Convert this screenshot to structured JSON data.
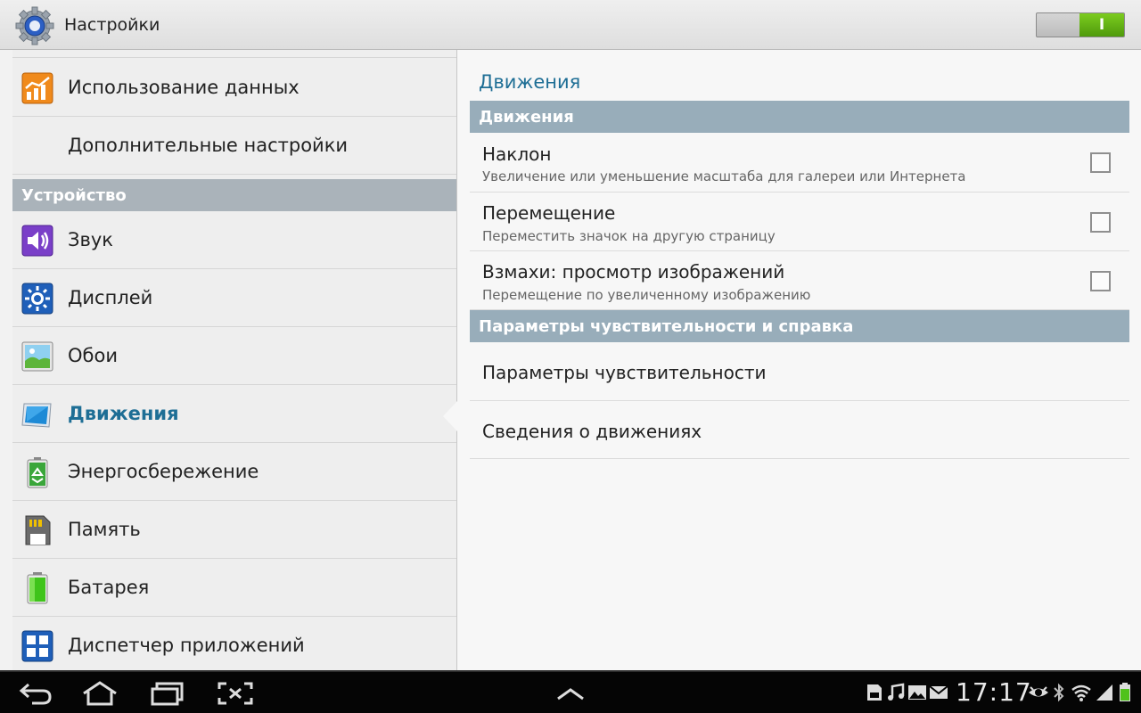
{
  "action_bar": {
    "title": "Настройки",
    "toggle_label": "I",
    "icon": "settings-gear-icon"
  },
  "sidebar": {
    "items_top": [
      {
        "label": "Использование данных",
        "icon": "data-usage-icon"
      },
      {
        "label": "Дополнительные настройки"
      }
    ],
    "section": "Устройство",
    "items": [
      {
        "label": "Звук",
        "icon": "sound-icon"
      },
      {
        "label": "Дисплей",
        "icon": "display-icon"
      },
      {
        "label": "Обои",
        "icon": "wallpaper-icon"
      },
      {
        "label": "Движения",
        "icon": "motion-icon",
        "active": true
      },
      {
        "label": "Энергосбережение",
        "icon": "power-saving-icon"
      },
      {
        "label": "Память",
        "icon": "storage-icon"
      },
      {
        "label": "Батарея",
        "icon": "battery-icon"
      },
      {
        "label": "Диспетчер приложений",
        "icon": "app-manager-icon"
      }
    ]
  },
  "main": {
    "title": "Движения",
    "section1": "Движения",
    "options": [
      {
        "title": "Наклон",
        "subtitle": "Увеличение или уменьшение масштаба для галереи или Интернета",
        "checked": false
      },
      {
        "title": "Перемещение",
        "subtitle": "Переместить значок на другую страницу",
        "checked": false
      },
      {
        "title": "Взмахи: просмотр изображений",
        "subtitle": "Перемещение по увеличенному изображению",
        "checked": false
      }
    ],
    "section2": "Параметры чувствительности и справка",
    "links": [
      {
        "title": "Параметры чувствительности"
      },
      {
        "title": "Сведения о движениях"
      }
    ]
  },
  "system_bar": {
    "time": "17:17",
    "icons": [
      "back-icon",
      "home-icon",
      "recent-apps-icon",
      "screenshot-icon",
      "up-arrow-icon",
      "sd-card-icon",
      "music-icon",
      "gallery-icon",
      "mail-icon",
      "smart-stay-icon",
      "bluetooth-icon",
      "wifi-icon",
      "signal-icon",
      "battery-status-icon"
    ]
  },
  "colors": {
    "accent": "#1e6e95",
    "section_header": "#98adba",
    "toggle_on": "#5ea512"
  }
}
